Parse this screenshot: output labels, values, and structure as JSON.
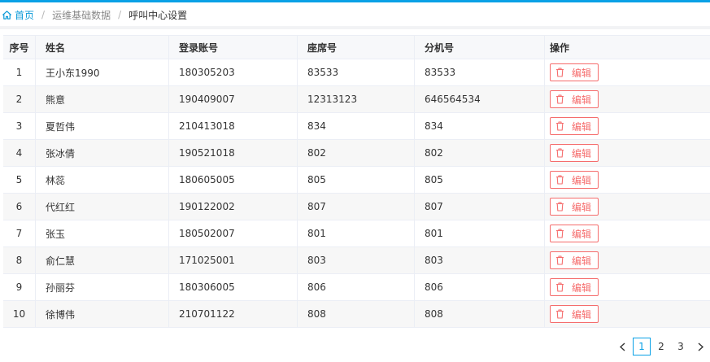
{
  "breadcrumb": {
    "home": "首页",
    "section": "运维基础数据",
    "current": "呼叫中心设置"
  },
  "table": {
    "columns": [
      "序号",
      "姓名",
      "登录账号",
      "座席号",
      "分机号",
      "操作"
    ],
    "rows": [
      {
        "idx": "1",
        "name": "王小东1990",
        "account": "180305203",
        "seat": "83533",
        "ext": "83533"
      },
      {
        "idx": "2",
        "name": "熊意",
        "account": "190409007",
        "seat": "12313123",
        "ext": "646564534"
      },
      {
        "idx": "3",
        "name": "夏哲伟",
        "account": "210413018",
        "seat": "834",
        "ext": "834"
      },
      {
        "idx": "4",
        "name": "张冰倩",
        "account": "190521018",
        "seat": "802",
        "ext": "802"
      },
      {
        "idx": "5",
        "name": "林蕊",
        "account": "180605005",
        "seat": "805",
        "ext": "805"
      },
      {
        "idx": "6",
        "name": "代红红",
        "account": "190122002",
        "seat": "807",
        "ext": "807"
      },
      {
        "idx": "7",
        "name": "张玉",
        "account": "180502007",
        "seat": "801",
        "ext": "801"
      },
      {
        "idx": "8",
        "name": "俞仁慧",
        "account": "171025001",
        "seat": "803",
        "ext": "803"
      },
      {
        "idx": "9",
        "name": "孙丽芬",
        "account": "180306005",
        "seat": "806",
        "ext": "806"
      },
      {
        "idx": "10",
        "name": "徐博伟",
        "account": "210701122",
        "seat": "808",
        "ext": "808"
      }
    ],
    "edit_label": "编辑"
  },
  "pagination": {
    "pages": [
      "1",
      "2",
      "3"
    ],
    "active": "1"
  },
  "icons": {
    "home": "home-icon",
    "edit": "trash-icon",
    "prev": "chevron-left-icon",
    "next": "chevron-right-icon"
  },
  "colors": {
    "accent": "#0aa1e6",
    "danger": "#f56c6c"
  }
}
